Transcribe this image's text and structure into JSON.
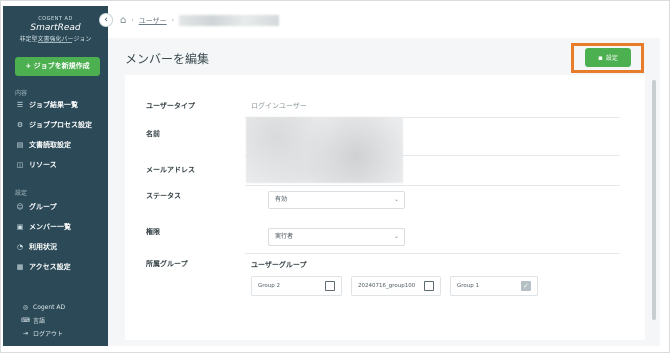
{
  "sidebar": {
    "brand_small": "COGENT AD",
    "brand_name": "SmartRead",
    "brand_sub": "非定型文書強化バージョン",
    "new_job_label": "+ ジョブを新規作成",
    "section_content": "内容",
    "section_settings": "設定",
    "items": [
      {
        "label": "ジョブ結果一覧",
        "icon": "list-icon"
      },
      {
        "label": "ジョブプロセス設定",
        "icon": "process-icon"
      },
      {
        "label": "文書読取設定",
        "icon": "document-icon"
      },
      {
        "label": "リソース",
        "icon": "resource-icon"
      },
      {
        "label": "グループ",
        "icon": "group-icon"
      },
      {
        "label": "メンバー一覧",
        "icon": "member-icon"
      },
      {
        "label": "利用状況",
        "icon": "usage-icon"
      },
      {
        "label": "アクセス設定",
        "icon": "access-icon"
      }
    ],
    "footer": [
      {
        "label": "Cogent AD",
        "icon": "user-icon"
      },
      {
        "label": "言語",
        "icon": "language-icon"
      },
      {
        "label": "ログアウト",
        "icon": "logout-icon"
      }
    ]
  },
  "breadcrumb": {
    "home_icon": "home-icon",
    "users_link": "ユーザー"
  },
  "page": {
    "title": "メンバーを編集",
    "save_label": "設定"
  },
  "form": {
    "user_type_label": "ユーザータイプ",
    "user_type_value": "ログインユーザー",
    "name_label": "名前",
    "email_label": "メールアドレス",
    "status_label": "ステータス",
    "status_value": "有効",
    "role_label": "権限",
    "role_value": "実行者",
    "group_label": "所属グループ",
    "group_title": "ユーザーグループ",
    "groups": [
      {
        "name": "Group 2",
        "checked": false
      },
      {
        "name": "20240716_group100",
        "checked": false
      },
      {
        "name": "Group 1",
        "checked": true
      }
    ]
  },
  "colors": {
    "sidebar_bg": "#2b4957",
    "accent_green": "#4caf50",
    "highlight_orange": "#e77d2a"
  }
}
